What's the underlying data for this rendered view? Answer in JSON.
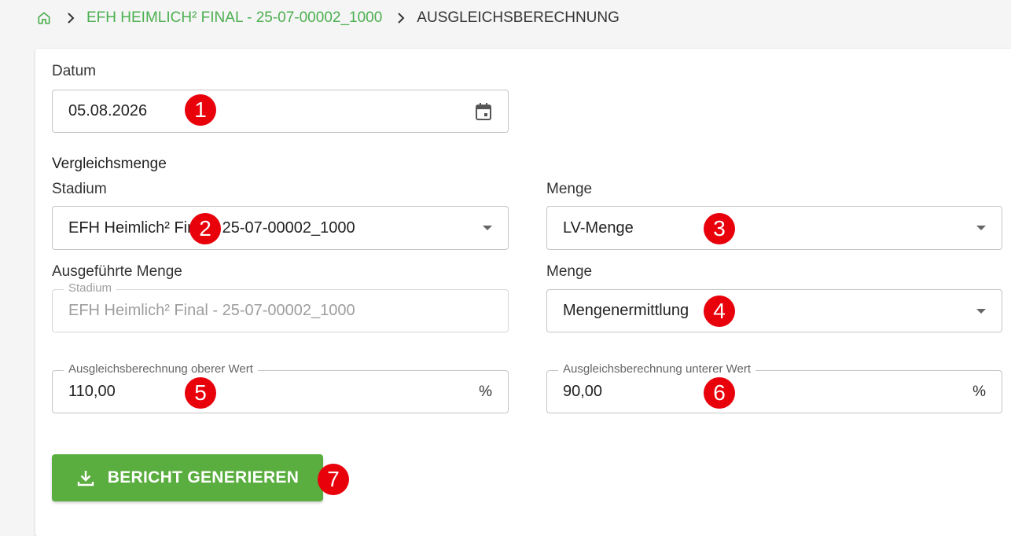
{
  "breadcrumb": {
    "home_icon": "home-icon",
    "project": "EFH HEIMLICH² FINAL - 25-07-00002_1000",
    "current": "AUSGLEICHSBERECHNUNG"
  },
  "form": {
    "datum_label": "Datum",
    "datum_value": "05.08.2026",
    "vergleichsmenge_heading": "Vergleichsmenge",
    "stadium_label": "Stadium",
    "stadium_value": "EFH Heimlich² Final - 25-07-00002_1000",
    "menge_label_1": "Menge",
    "menge_value_1": "LV-Menge",
    "ausgefuehrte_label": "Ausgeführte Menge",
    "ausgefuehrte_stadium_float": "Stadium",
    "ausgefuehrte_stadium_value": "EFH Heimlich² Final - 25-07-00002_1000",
    "menge_label_2": "Menge",
    "menge_value_2": "Mengenermittlung",
    "oberer_label": "Ausgleichsberechnung oberer Wert",
    "oberer_value": "110,00",
    "oberer_suffix": "%",
    "unterer_label": "Ausgleichsberechnung unterer Wert",
    "unterer_value": "90,00",
    "unterer_suffix": "%"
  },
  "button": {
    "label": "BERICHT GENERIEREN",
    "icon": "download-icon"
  },
  "badges": [
    "1",
    "2",
    "3",
    "4",
    "5",
    "6",
    "7"
  ],
  "colors": {
    "accent": "#4caf50",
    "button": "#5aad3f",
    "badge": "#e8000b"
  }
}
